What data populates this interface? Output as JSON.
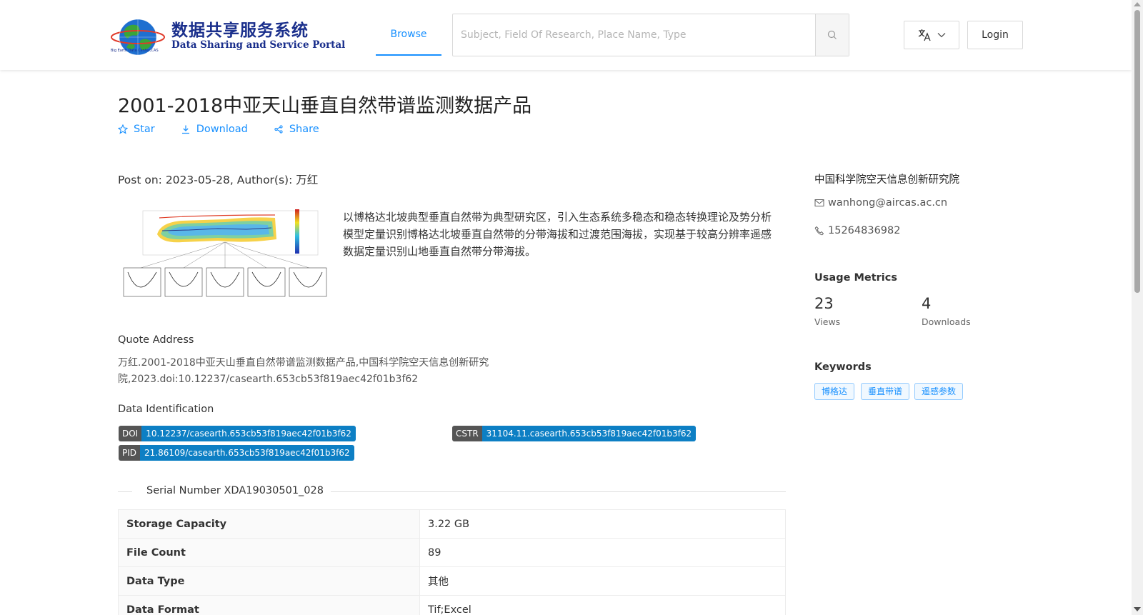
{
  "header": {
    "logo_cn": "数据共享服务系统",
    "logo_en": "Data Sharing and Service Portal",
    "logo_small": "Big Earth Data Center,CAS",
    "nav_browse": "Browse",
    "search_placeholder": "Subject, Field Of Research, Place Name, Type",
    "login": "Login"
  },
  "dataset": {
    "title": "2001-2018中亚天山垂直自然带谱监测数据产品",
    "actions": {
      "star": "Star",
      "download": "Download",
      "share": "Share"
    },
    "post_on": "Post on: 2023-05-28, Author(s): 万红",
    "abstract": "以博格达北坡典型垂直自然带为典型研究区，引入生态系统多稳态和稳态转换理论及势分析模型定量识别博格达北坡垂直自然带的分带海拔和过渡范围海拔，实现基于较高分辨率遥感数据定量识别山地垂直自然带分带海拔。",
    "quote_label": "Quote Address",
    "quote_text": "万红.2001-2018中亚天山垂直自然带谱监测数据产品,中国科学院空天信息创新研究院,2023.doi:10.12237/casearth.653cb53f819aec42f01b3f62",
    "data_id_label": "Data Identification",
    "identifiers": {
      "doi_key": "DOI",
      "doi_val": "10.12237/casearth.653cb53f819aec42f01b3f62",
      "cstr_key": "CSTR",
      "cstr_val": "31104.11.casearth.653cb53f819aec42f01b3f62",
      "pid_key": "PID",
      "pid_val": "21.86109/casearth.653cb53f819aec42f01b3f62"
    },
    "serial": "Serial Number XDA19030501_028",
    "info": [
      {
        "key": "Storage Capacity",
        "value": "3.22 GB"
      },
      {
        "key": "File Count",
        "value": "89"
      },
      {
        "key": "Data Type",
        "value": "其他"
      },
      {
        "key": "Data Format",
        "value": "Tif;Excel"
      }
    ]
  },
  "sidebar": {
    "organization": "中国科学院空天信息创新研究院",
    "email": "wanhong@aircas.ac.cn",
    "phone": "15264836982",
    "usage_title": "Usage Metrics",
    "views_count": "23",
    "views_label": "Views",
    "downloads_count": "4",
    "downloads_label": "Downloads",
    "keywords_title": "Keywords",
    "keywords": [
      "博格达",
      "垂直带谱",
      "遥感参数"
    ]
  },
  "colors": {
    "accent": "#1890ff",
    "badge_value": "#0d7fc4",
    "badge_key": "#555555",
    "logo": "#1a2f8c"
  }
}
